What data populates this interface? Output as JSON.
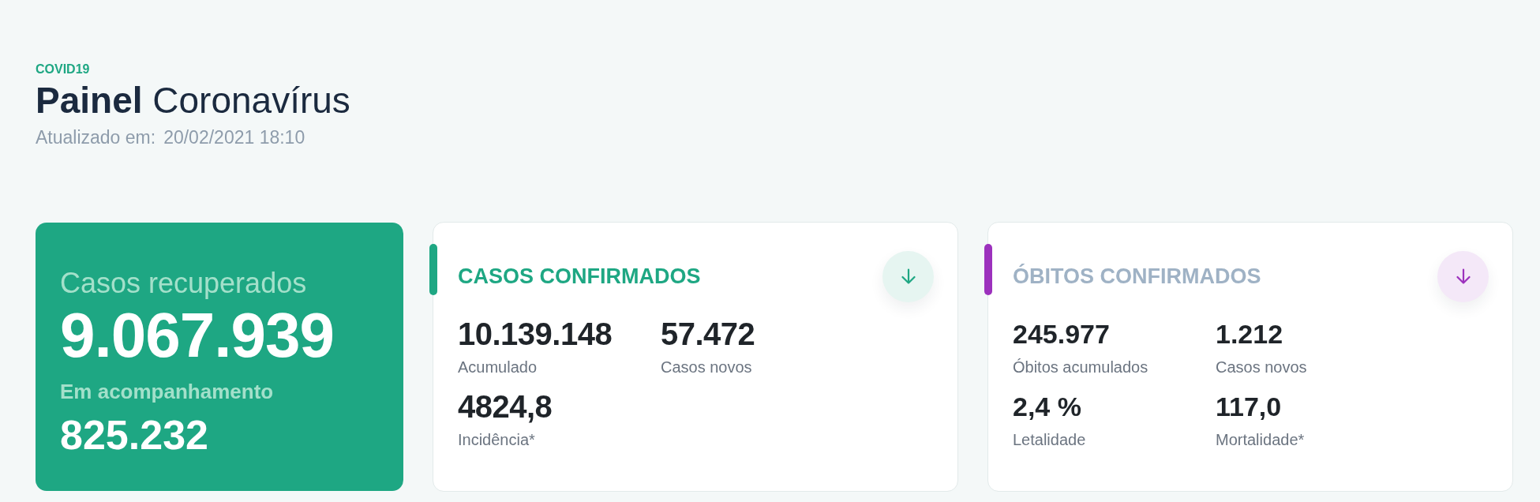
{
  "header": {
    "eyebrow": "COVID19",
    "title": "**Painel** Coronavírus",
    "updated_label": "Atualizado em:",
    "updated_value": "20/02/2021 18:10"
  },
  "recovered_card": {
    "title": "Casos recuperados",
    "value": "9.067.939",
    "sub_label": "Em acompanhamento",
    "sub_value": "825.232"
  },
  "stat_cards": [
    {
      "kind": "cases",
      "color": "#1ea783",
      "title": "CASOS CONFIRMADOS",
      "metrics": [
        {
          "value": "10.139.148",
          "label": "Acumulado"
        },
        {
          "value": "57.472",
          "label": "Casos novos"
        },
        {
          "value": "4824,8",
          "label": "Incidência*"
        }
      ]
    },
    {
      "kind": "deaths",
      "color": "#9c31bd",
      "title": "ÓBITOS CONFIRMADOS",
      "metrics": [
        {
          "value": "245.977",
          "label": "Óbitos acumulados"
        },
        {
          "value": "1.212",
          "label": "Casos novos"
        },
        {
          "value": "2,4 %",
          "label": "Letalidade"
        },
        {
          "value": "117,0",
          "label": "Mortalidade*"
        }
      ]
    }
  ]
}
